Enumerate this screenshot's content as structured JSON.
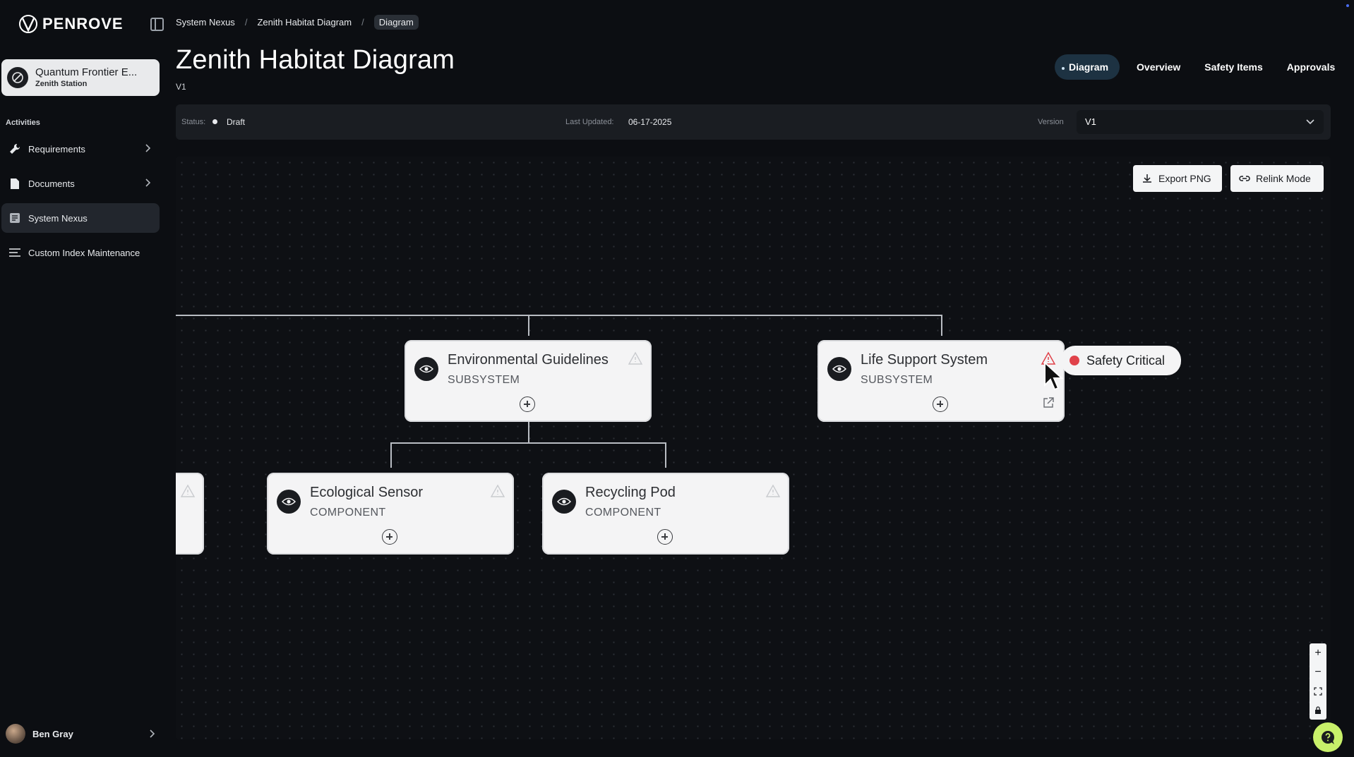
{
  "brand": {
    "name": "PENROVE"
  },
  "project": {
    "name": "Quantum Frontier E...",
    "station": "Zenith Station"
  },
  "sidebar": {
    "section_label": "Activities",
    "items": [
      {
        "label": "Requirements",
        "icon": "wrench-icon",
        "has_chevron": true
      },
      {
        "label": "Documents",
        "icon": "document-icon",
        "has_chevron": true
      },
      {
        "label": "System Nexus",
        "icon": "nexus-icon",
        "active": true
      },
      {
        "label": "Custom Index Maintenance",
        "icon": "list-icon"
      }
    ],
    "user": {
      "name": "Ben Gray"
    }
  },
  "breadcrumb": [
    "System Nexus",
    "Zenith Habitat Diagram",
    "Diagram"
  ],
  "header": {
    "title": "Zenith Habitat Diagram",
    "version": "V1"
  },
  "tabs": [
    {
      "label": "Diagram",
      "active": true
    },
    {
      "label": "Overview"
    },
    {
      "label": "Safety Items"
    },
    {
      "label": "Approvals"
    }
  ],
  "status_bar": {
    "status_label": "Status:",
    "status_value": "Draft",
    "updated_label": "Last Updated:",
    "updated_value": "06-17-2025",
    "version_label": "Version",
    "version_value": "V1"
  },
  "canvas": {
    "export_label": "Export PNG",
    "relink_label": "Relink Mode",
    "nodes": [
      {
        "title": "Environmental Guidelines",
        "type": "SUBSYSTEM"
      },
      {
        "title": "Life Support System",
        "type": "SUBSYSTEM"
      },
      {
        "title": "Ecological Sensor",
        "type": "COMPONENT"
      },
      {
        "title": "Recycling Pod",
        "type": "COMPONENT"
      }
    ],
    "safety_badge": "Safety Critical",
    "zoom_controls": [
      "+",
      "−",
      "⛶",
      "🔒"
    ]
  },
  "colors": {
    "background": "#0c0e12",
    "active_tab": "#1d3242",
    "node_fill": "#f4f4f5",
    "safety_red": "#e0424a",
    "help_fab": "#c8f06a",
    "warning_active": "#e0424a"
  }
}
